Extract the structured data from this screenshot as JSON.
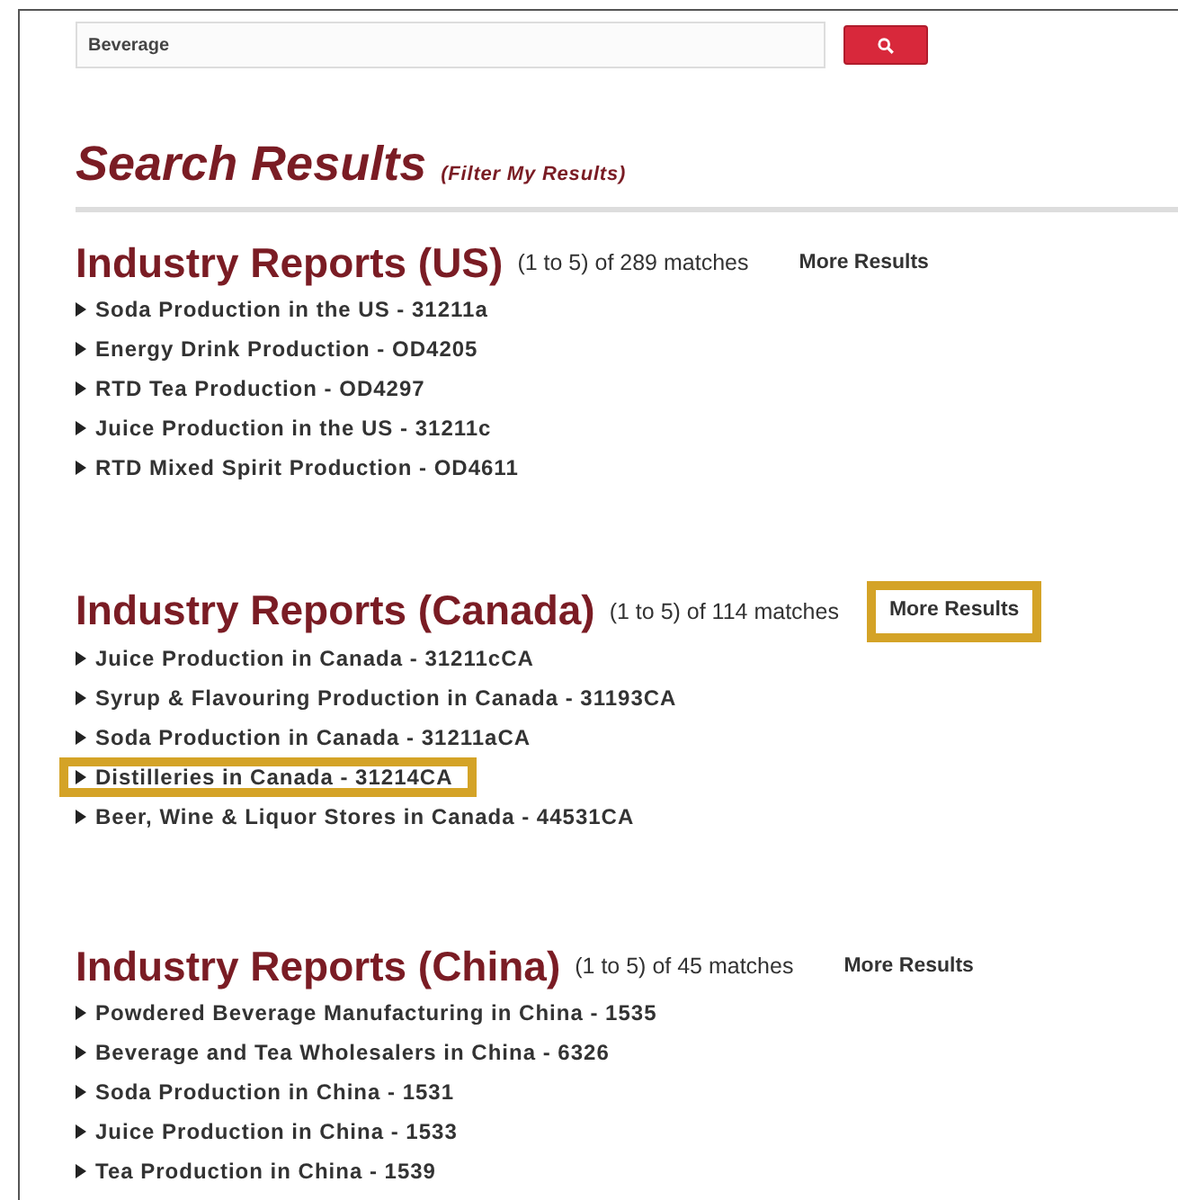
{
  "search": {
    "value": "Beverage"
  },
  "title": "Search Results",
  "filter_link": "(Filter My Results)",
  "sections": [
    {
      "heading": "Industry Reports (US)",
      "count": "(1 to 5) of 289 matches",
      "more": {
        "label": "More Results",
        "highlighted": false
      },
      "items": [
        {
          "label": "Soda Production in the US - 31211a",
          "highlighted": false
        },
        {
          "label": "Energy Drink Production - OD4205",
          "highlighted": false
        },
        {
          "label": "RTD Tea Production - OD4297",
          "highlighted": false
        },
        {
          "label": "Juice Production in the US - 31211c",
          "highlighted": false
        },
        {
          "label": "RTD Mixed Spirit Production - OD4611",
          "highlighted": false
        }
      ]
    },
    {
      "heading": "Industry Reports (Canada)",
      "count": "(1 to 5) of 114 matches",
      "more": {
        "label": "More Results",
        "highlighted": true
      },
      "items": [
        {
          "label": "Juice Production in Canada - 31211cCA",
          "highlighted": false
        },
        {
          "label": "Syrup & Flavouring Production in Canada - 31193CA",
          "highlighted": false
        },
        {
          "label": "Soda Production in Canada - 31211aCA",
          "highlighted": false
        },
        {
          "label": "Distilleries in Canada - 31214CA",
          "highlighted": true
        },
        {
          "label": "Beer, Wine & Liquor Stores in Canada - 44531CA",
          "highlighted": false
        }
      ]
    },
    {
      "heading": "Industry Reports (China)",
      "count": "(1 to 5) of 45 matches",
      "more": {
        "label": "More Results",
        "highlighted": false
      },
      "items": [
        {
          "label": "Powdered Beverage Manufacturing in China - 1535",
          "highlighted": false
        },
        {
          "label": "Beverage and Tea Wholesalers in China - 6326",
          "highlighted": false
        },
        {
          "label": "Soda Production in China - 1531",
          "highlighted": false
        },
        {
          "label": "Juice Production in China - 1533",
          "highlighted": false
        },
        {
          "label": "Tea Production in China - 1539",
          "highlighted": false
        }
      ]
    }
  ]
}
